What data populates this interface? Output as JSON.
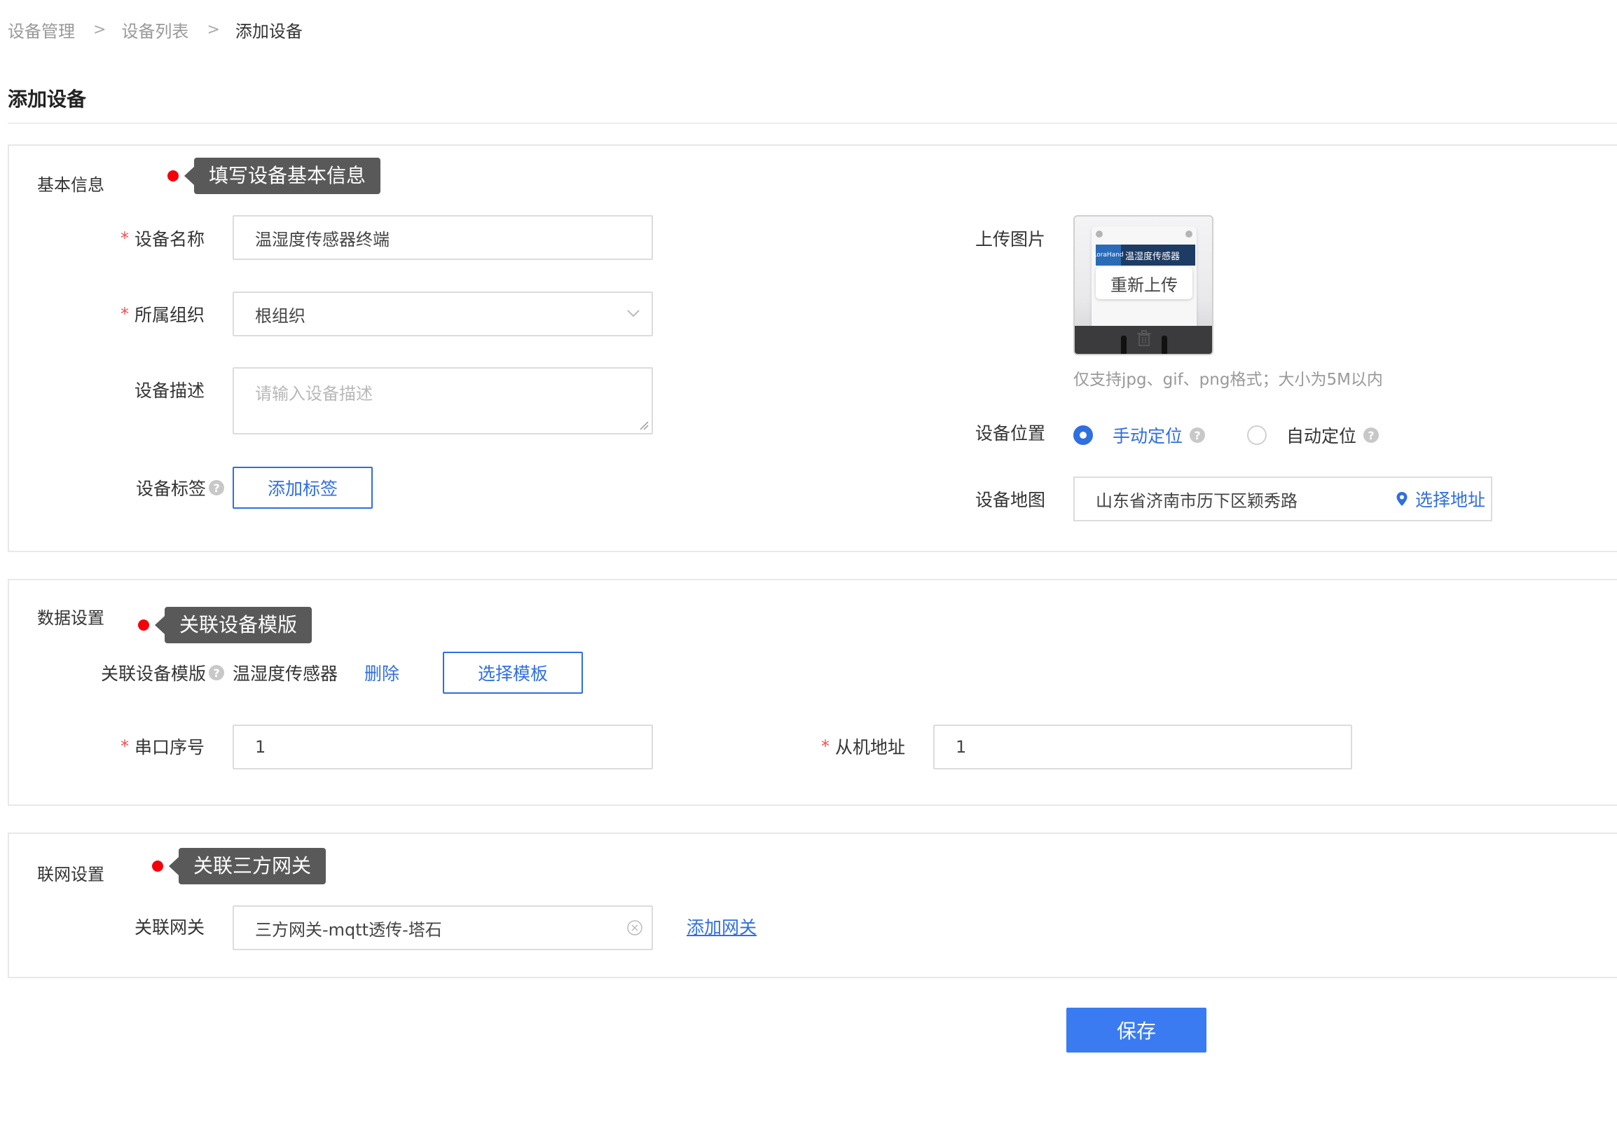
{
  "breadcrumb": {
    "items": [
      "设备管理",
      "设备列表",
      "添加设备"
    ],
    "separator": ">"
  },
  "page": {
    "title": "添加设备"
  },
  "basic": {
    "section_label": "基本信息",
    "tip": "填写设备基本信息",
    "device_name": {
      "label": "设备名称",
      "value": "温湿度传感器终端"
    },
    "org": {
      "label": "所属组织",
      "value": "根组织"
    },
    "desc": {
      "label": "设备描述",
      "placeholder": "请输入设备描述"
    },
    "tags": {
      "label": "设备标签",
      "button": "添加标签"
    },
    "upload": {
      "label": "上传图片",
      "reupload": "重新上传",
      "hint": "仅支持jpg、gif、png格式；大小为5M以内",
      "device_text": "温湿度传感器",
      "brand_text": "LoraHand"
    },
    "location": {
      "label": "设备位置",
      "manual": "手动定位",
      "auto": "自动定位",
      "selected": "manual"
    },
    "map": {
      "label": "设备地图",
      "value": "山东省济南市历下区颖秀路",
      "select": "选择地址"
    }
  },
  "data": {
    "section_label": "数据设置",
    "tip": "关联设备模版",
    "template": {
      "label": "关联设备模版",
      "value": "温湿度传感器",
      "delete": "删除",
      "select": "选择模板"
    },
    "serial": {
      "label": "串口序号",
      "value": "1"
    },
    "slave": {
      "label": "从机地址",
      "value": "1"
    }
  },
  "network": {
    "section_label": "联网设置",
    "tip": "关联三方网关",
    "gateway": {
      "label": "关联网关",
      "value": "三方网关-mqtt透传-塔石",
      "add": "添加网关"
    }
  },
  "actions": {
    "save": "保存"
  },
  "colors": {
    "primary": "#2f6fe0",
    "save": "#3a7bf2",
    "required": "#f05050",
    "tip_dot": "#f5000a",
    "tip_bg": "#595959"
  }
}
